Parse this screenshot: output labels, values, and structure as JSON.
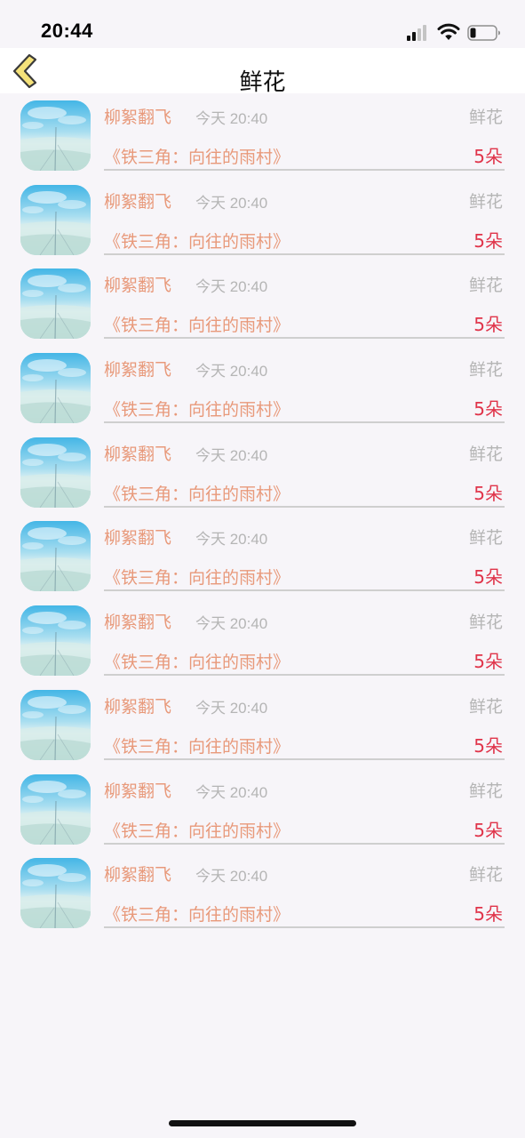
{
  "status_bar": {
    "time": "20:44"
  },
  "nav": {
    "title": "鲜花",
    "back_icon": "chevron-left-icon"
  },
  "colors": {
    "accent": "#e8997a",
    "count_red": "#e0344a",
    "muted": "#b5b5b5",
    "back_chevron_fill": "#f5e27a"
  },
  "records": [
    {
      "user": "柳絮翻飞",
      "time": "今天 20:40",
      "gift": "鲜花",
      "book": "《铁三角：向往的雨村》",
      "count": "5朵"
    },
    {
      "user": "柳絮翻飞",
      "time": "今天 20:40",
      "gift": "鲜花",
      "book": "《铁三角：向往的雨村》",
      "count": "5朵"
    },
    {
      "user": "柳絮翻飞",
      "time": "今天 20:40",
      "gift": "鲜花",
      "book": "《铁三角：向往的雨村》",
      "count": "5朵"
    },
    {
      "user": "柳絮翻飞",
      "time": "今天 20:40",
      "gift": "鲜花",
      "book": "《铁三角：向往的雨村》",
      "count": "5朵"
    },
    {
      "user": "柳絮翻飞",
      "time": "今天 20:40",
      "gift": "鲜花",
      "book": "《铁三角：向往的雨村》",
      "count": "5朵"
    },
    {
      "user": "柳絮翻飞",
      "time": "今天 20:40",
      "gift": "鲜花",
      "book": "《铁三角：向往的雨村》",
      "count": "5朵"
    },
    {
      "user": "柳絮翻飞",
      "time": "今天 20:40",
      "gift": "鲜花",
      "book": "《铁三角：向往的雨村》",
      "count": "5朵"
    },
    {
      "user": "柳絮翻飞",
      "time": "今天 20:40",
      "gift": "鲜花",
      "book": "《铁三角：向往的雨村》",
      "count": "5朵"
    },
    {
      "user": "柳絮翻飞",
      "time": "今天 20:40",
      "gift": "鲜花",
      "book": "《铁三角：向往的雨村》",
      "count": "5朵"
    },
    {
      "user": "柳絮翻飞",
      "time": "今天 20:40",
      "gift": "鲜花",
      "book": "《铁三角：向往的雨村》",
      "count": "5朵"
    }
  ]
}
